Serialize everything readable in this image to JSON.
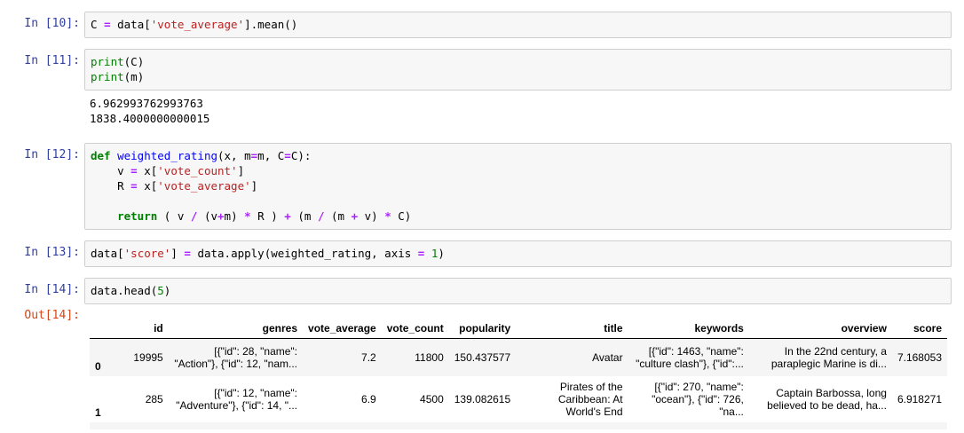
{
  "cells": [
    {
      "prompt": "In [10]:",
      "code": "C = data['vote_average'].mean()"
    },
    {
      "prompt": "In [11]:",
      "code_lines": [
        "print(C)",
        "print(m)"
      ],
      "stdout": [
        "6.962993762993763",
        "1838.4000000000015"
      ]
    },
    {
      "prompt": "In [12]:",
      "code_lines": [
        "def weighted_rating(x, m=m, C=C):",
        "    v = x['vote_count']",
        "    R = x['vote_average']",
        "",
        "    return ( v / (v+m) * R ) + (m / (m + v) * C)"
      ]
    },
    {
      "prompt": "In [13]:",
      "code": "data['score'] = data.apply(weighted_rating, axis = 1)"
    },
    {
      "prompt": "In [14]:",
      "code": "data.head(5)"
    }
  ],
  "output_prompt": "Out[14]:",
  "table": {
    "columns": [
      "",
      "id",
      "genres",
      "vote_average",
      "vote_count",
      "popularity",
      "title",
      "keywords",
      "overview",
      "score"
    ],
    "rows": [
      {
        "index": "0",
        "id": "19995",
        "genres": "[{\"id\": 28, \"name\": \"Action\"}, {\"id\": 12, \"nam...",
        "vote_average": "7.2",
        "vote_count": "11800",
        "popularity": "150.437577",
        "title": "Avatar",
        "keywords": "[{\"id\": 1463, \"name\": \"culture clash\"}, {\"id\":...",
        "overview": "In the 22nd century, a paraplegic Marine is di...",
        "score": "7.168053"
      },
      {
        "index": "1",
        "id": "285",
        "genres": "[{\"id\": 12, \"name\": \"Adventure\"}, {\"id\": 14, \"...",
        "vote_average": "6.9",
        "vote_count": "4500",
        "popularity": "139.082615",
        "title": "Pirates of the Caribbean: At World's End",
        "keywords": "[{\"id\": 270, \"name\": \"ocean\"}, {\"id\": 726, \"na...",
        "overview": "Captain Barbossa, long believed to be dead, ha...",
        "score": "6.918271"
      }
    ]
  }
}
